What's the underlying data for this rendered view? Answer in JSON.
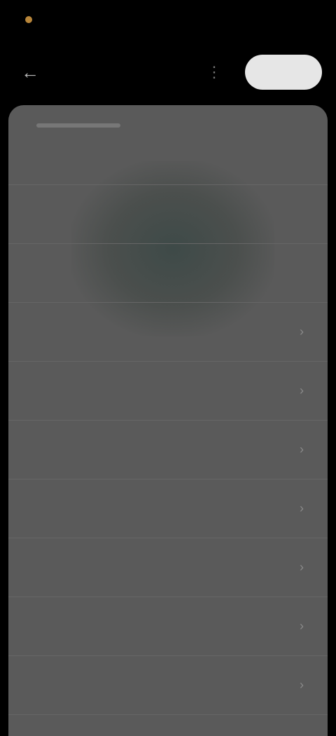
{
  "status_bar": {
    "time": "",
    "indicators": ""
  },
  "app_bar": {
    "back_icon": "arrow-back-icon",
    "action_icon": "more-icon",
    "primary_button_label": ""
  },
  "sheet": {
    "options": [
      {
        "label": ""
      },
      {
        "label": ""
      },
      {
        "label": ""
      },
      {
        "label": ""
      },
      {
        "label": ""
      },
      {
        "label": ""
      },
      {
        "label": ""
      },
      {
        "label": ""
      },
      {
        "label": ""
      },
      {
        "label": ""
      }
    ]
  },
  "colors": {
    "background": "#000000",
    "sheet": "#5a5a5a",
    "primary_button": "#e6e6e6",
    "status_accent": "#b8863a"
  }
}
